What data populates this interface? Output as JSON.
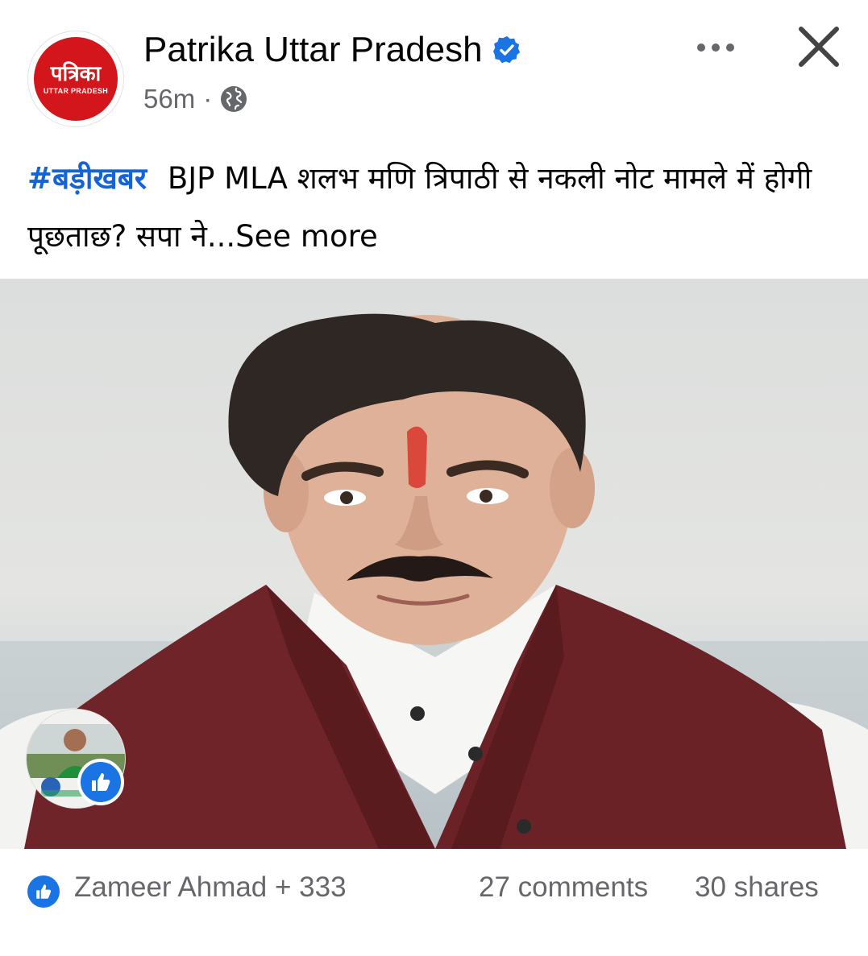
{
  "post": {
    "page_name": "Patrika Uttar Pradesh",
    "logo_text": "पत्रिका",
    "logo_subtext": "UTTAR PRADESH",
    "time": "56m",
    "separator": "·",
    "audience_icon": "globe-icon",
    "verified_icon": "verified-badge-icon",
    "hashtag": "#बड़ीखबर",
    "text_part": "BJP MLA शलभ मणि त्रिपाठी से नकली नोट मामले में होगी पूछताछ? सपा ने...",
    "see_more": "See more"
  },
  "engagement": {
    "reactions": "Zameer Ahmad + 333",
    "comments": "27 comments",
    "shares": "30 shares",
    "reaction_icon": "like-icon"
  },
  "colors": {
    "brand_red": "#d3161b",
    "link_blue": "#1464d9",
    "like_blue": "#1b74e4",
    "secondary_text": "#65676b"
  }
}
